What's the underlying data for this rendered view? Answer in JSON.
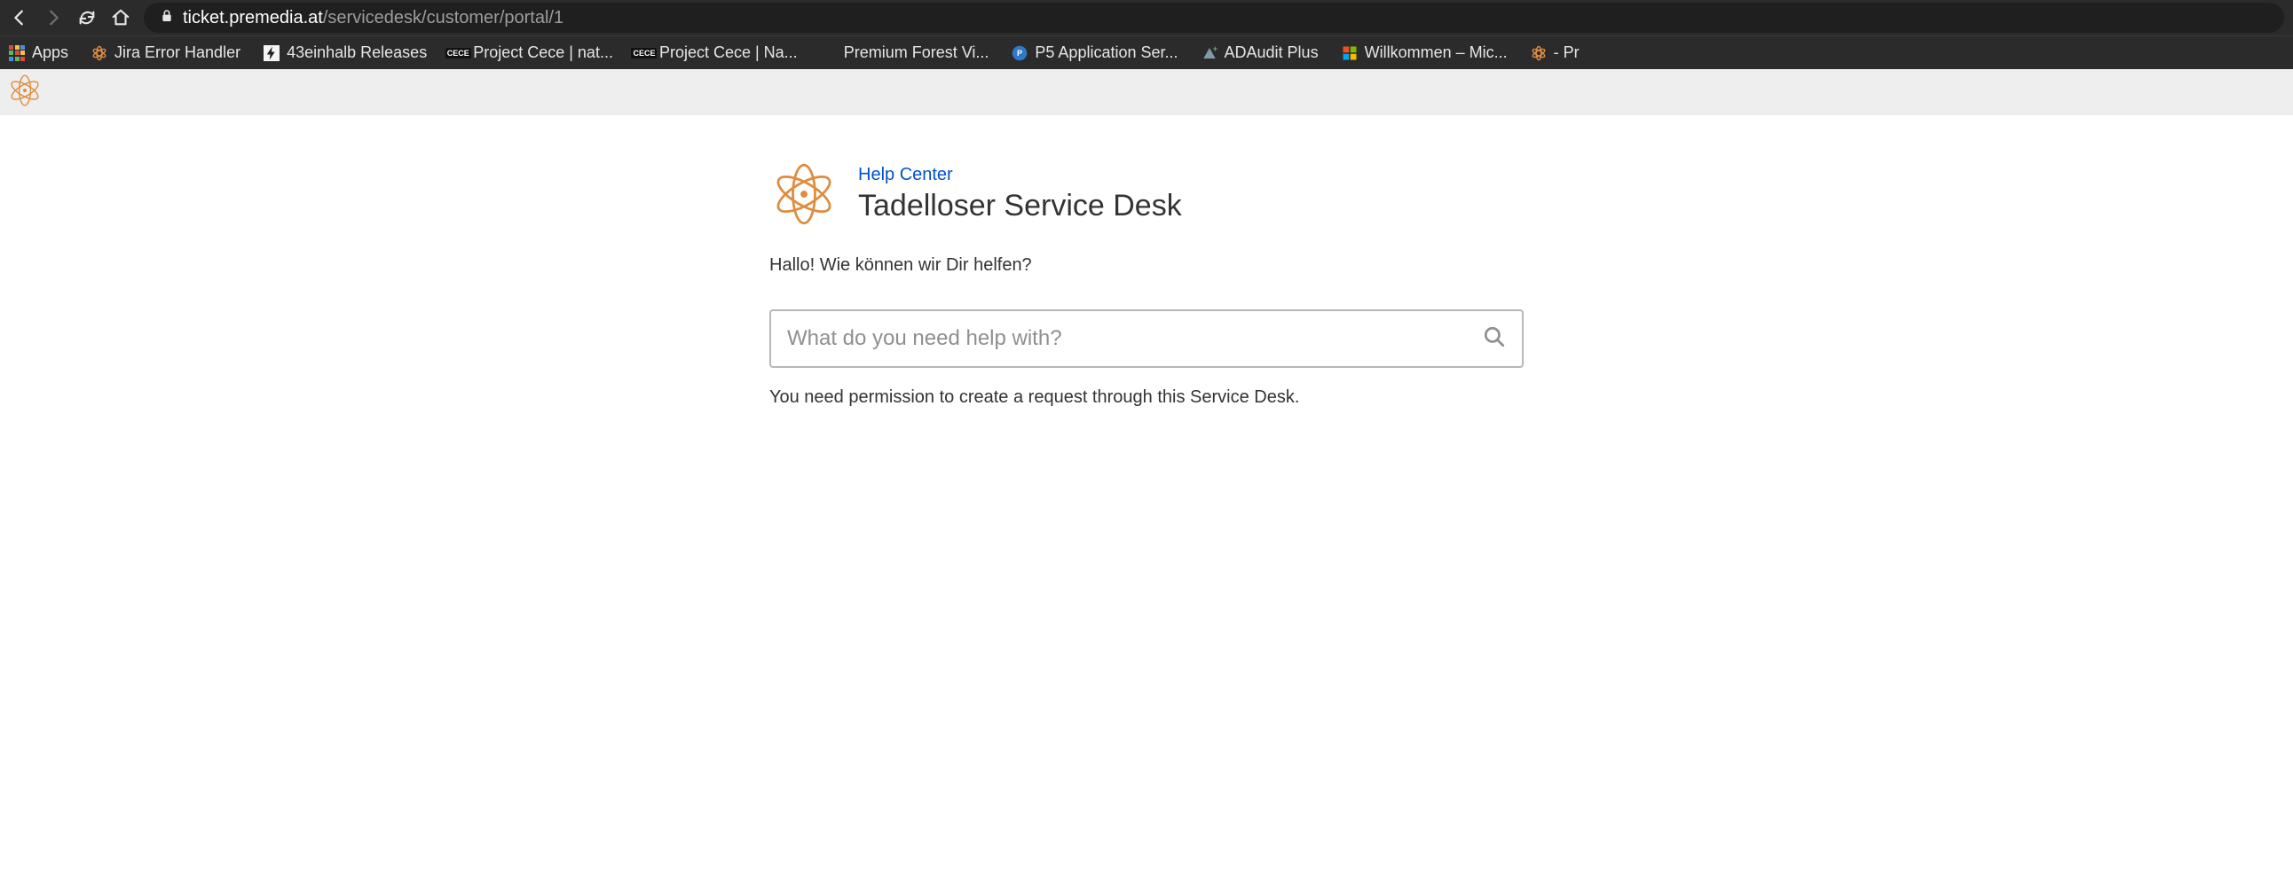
{
  "browser": {
    "url_host": "ticket.premedia.at",
    "url_path": "/servicedesk/customer/portal/1",
    "bookmarks": [
      {
        "label": "Apps",
        "icon": "apps"
      },
      {
        "label": "Jira Error Handler",
        "icon": "atom"
      },
      {
        "label": "43einhalb Releases",
        "icon": "bolt"
      },
      {
        "label": "Project Cece | nat...",
        "icon": "cece"
      },
      {
        "label": "Project Cece | Na...",
        "icon": "cece"
      },
      {
        "label": "Premium Forest Vi...",
        "icon": "blank"
      },
      {
        "label": "P5 Application Ser...",
        "icon": "p5"
      },
      {
        "label": "ADAudit Plus",
        "icon": "adaudit"
      },
      {
        "label": "Willkommen – Mic...",
        "icon": "ms"
      },
      {
        "label": "- Pr",
        "icon": "atom"
      }
    ]
  },
  "portal": {
    "help_center_label": "Help Center",
    "desk_title": "Tadelloser Service Desk",
    "greeting": "Hallo! Wie können wir Dir helfen?",
    "search_placeholder": "What do you need help with?",
    "permission_msg": "You need permission to create a request through this Service Desk."
  }
}
